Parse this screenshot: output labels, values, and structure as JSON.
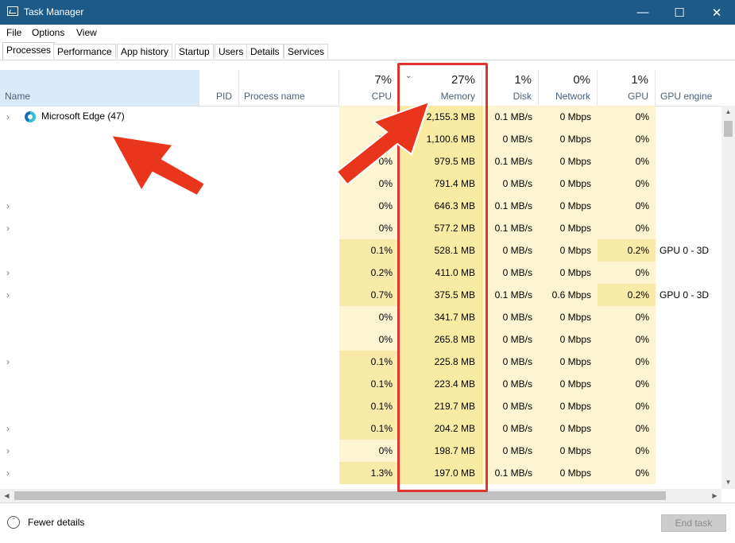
{
  "window": {
    "title": "Task Manager",
    "minimize": "—",
    "maximize": "☐",
    "close": "✕"
  },
  "menu": {
    "items": [
      "File",
      "Options",
      "View"
    ]
  },
  "tabs": [
    "Processes",
    "Performance",
    "App history",
    "Startup",
    "Users",
    "Details",
    "Services"
  ],
  "columns": {
    "name": "Name",
    "pid": "PID",
    "process_name": "Process name",
    "cpu": {
      "pct": "7%",
      "label": "CPU"
    },
    "memory": {
      "pct": "27%",
      "label": "Memory"
    },
    "disk": {
      "pct": "1%",
      "label": "Disk"
    },
    "network": {
      "pct": "0%",
      "label": "Network"
    },
    "gpu": {
      "pct": "1%",
      "label": "GPU"
    },
    "gpu_engine": "GPU engine"
  },
  "rows": [
    {
      "name": "Microsoft Edge (47)",
      "cpu": "",
      "memory": "2,155.3 MB",
      "disk": "0.1 MB/s",
      "network": "0 Mbps",
      "gpu": "0%",
      "gpu_engine": ""
    },
    {
      "name": "",
      "cpu": "0%",
      "memory": "1,100.6 MB",
      "disk": "0 MB/s",
      "network": "0 Mbps",
      "gpu": "0%",
      "gpu_engine": ""
    },
    {
      "name": "",
      "cpu": "0%",
      "memory": "979.5 MB",
      "disk": "0.1 MB/s",
      "network": "0 Mbps",
      "gpu": "0%",
      "gpu_engine": ""
    },
    {
      "name": "",
      "cpu": "0%",
      "memory": "791.4 MB",
      "disk": "0 MB/s",
      "network": "0 Mbps",
      "gpu": "0%",
      "gpu_engine": ""
    },
    {
      "name": "",
      "cpu": "0%",
      "memory": "646.3 MB",
      "disk": "0.1 MB/s",
      "network": "0 Mbps",
      "gpu": "0%",
      "gpu_engine": ""
    },
    {
      "name": "",
      "cpu": "0%",
      "memory": "577.2 MB",
      "disk": "0.1 MB/s",
      "network": "0 Mbps",
      "gpu": "0%",
      "gpu_engine": ""
    },
    {
      "name": "",
      "cpu": "0.1%",
      "memory": "528.1 MB",
      "disk": "0 MB/s",
      "network": "0 Mbps",
      "gpu": "0.2%",
      "gpu_engine": "GPU 0 - 3D"
    },
    {
      "name": "",
      "cpu": "0.2%",
      "memory": "411.0 MB",
      "disk": "0 MB/s",
      "network": "0 Mbps",
      "gpu": "0%",
      "gpu_engine": ""
    },
    {
      "name": "",
      "cpu": "0.7%",
      "memory": "375.5 MB",
      "disk": "0.1 MB/s",
      "network": "0.6 Mbps",
      "gpu": "0.2%",
      "gpu_engine": "GPU 0 - 3D"
    },
    {
      "name": "",
      "cpu": "0%",
      "memory": "341.7 MB",
      "disk": "0 MB/s",
      "network": "0 Mbps",
      "gpu": "0%",
      "gpu_engine": ""
    },
    {
      "name": "",
      "cpu": "0%",
      "memory": "265.8 MB",
      "disk": "0 MB/s",
      "network": "0 Mbps",
      "gpu": "0%",
      "gpu_engine": ""
    },
    {
      "name": "",
      "cpu": "0.1%",
      "memory": "225.8 MB",
      "disk": "0 MB/s",
      "network": "0 Mbps",
      "gpu": "0%",
      "gpu_engine": ""
    },
    {
      "name": "",
      "cpu": "0.1%",
      "memory": "223.4 MB",
      "disk": "0 MB/s",
      "network": "0 Mbps",
      "gpu": "0%",
      "gpu_engine": ""
    },
    {
      "name": "",
      "cpu": "0.1%",
      "memory": "219.7 MB",
      "disk": "0 MB/s",
      "network": "0 Mbps",
      "gpu": "0%",
      "gpu_engine": ""
    },
    {
      "name": "",
      "cpu": "0.1%",
      "memory": "204.2 MB",
      "disk": "0 MB/s",
      "network": "0 Mbps",
      "gpu": "0%",
      "gpu_engine": ""
    },
    {
      "name": "",
      "cpu": "0%",
      "memory": "198.7 MB",
      "disk": "0 MB/s",
      "network": "0 Mbps",
      "gpu": "0%",
      "gpu_engine": ""
    },
    {
      "name": "",
      "cpu": "1.3%",
      "memory": "197.0 MB",
      "disk": "0.1 MB/s",
      "network": "0 Mbps",
      "gpu": "0%",
      "gpu_engine": ""
    }
  ],
  "footer": {
    "fewer_details": "Fewer details",
    "end_task": "End task"
  },
  "colors": {
    "titlebar": "#1d5a87",
    "memory_heat": "#f9eba1",
    "light_heat": "#fdf5d2",
    "mid_heat": "#f9eaaa",
    "callout": "#e03430"
  }
}
